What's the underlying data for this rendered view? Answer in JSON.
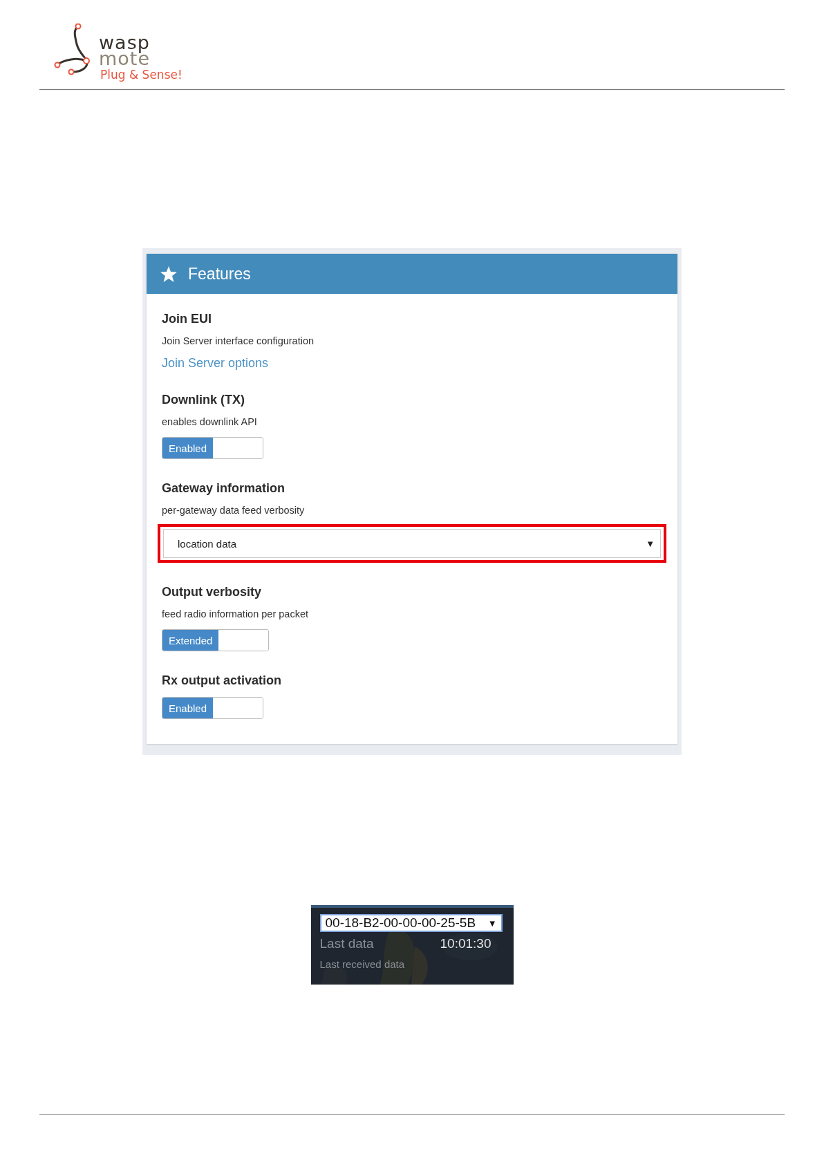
{
  "logo": {
    "line1": "wasp",
    "line2": "mote",
    "tagline": "Plug & Sense!"
  },
  "panel": {
    "title": "Features",
    "sections": [
      {
        "kind": "link",
        "title": "Join EUI",
        "description": "Join Server interface configuration",
        "link": "Join Server options"
      },
      {
        "kind": "toggle",
        "title": "Downlink (TX)",
        "description": "enables downlink API",
        "toggle": {
          "label": "Enabled",
          "on": true
        }
      },
      {
        "kind": "select",
        "title": "Gateway information",
        "description": "per-gateway data feed verbosity",
        "select": {
          "value": "location data",
          "arrow": "▼",
          "highlighted": true
        }
      },
      {
        "kind": "toggle",
        "title": "Output verbosity",
        "description": "feed radio information per packet",
        "toggle": {
          "label": "Extended",
          "on": true
        }
      },
      {
        "kind": "toggle",
        "title": "Rx output activation",
        "toggle": {
          "label": "Enabled",
          "on": true
        }
      }
    ]
  },
  "widget": {
    "select": {
      "value": "00-18-B2-00-00-00-25-5B",
      "arrow": "▼"
    },
    "label": "Last data",
    "time": "10:01:30",
    "caption": "Last received data"
  }
}
